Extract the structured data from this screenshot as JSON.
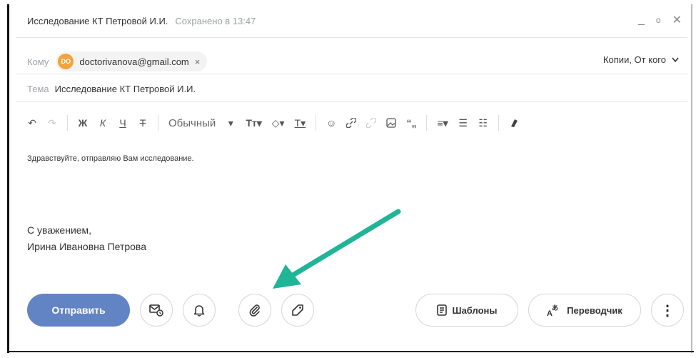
{
  "window": {
    "title": "Исследование КТ Петровой И.И.",
    "saved_status": "Сохранено в 13:47",
    "minimize_glyph": "_",
    "restore_glyph": "o",
    "close_glyph": "✕"
  },
  "to_field": {
    "label": "Кому",
    "recipient_initials": "DO",
    "recipient_email": "doctorivanova@gmail.com",
    "remove_glyph": "×",
    "cc_label": "Копии, От кого",
    "cc_chevron": "v"
  },
  "subject": {
    "label": "Тема",
    "value": "Исследование КТ Петровой И.И."
  },
  "toolbar": {
    "undo": "↶",
    "redo": "↷",
    "bold": "Ж",
    "italic": "К",
    "underline": "Ч",
    "strike": "Т",
    "font_style": "Обычный",
    "font_dropdown": "▾",
    "text_size": "Тт▾",
    "fill_color": "◇▾",
    "text_color": "T▾",
    "emoji": "☺",
    "link": "🔗",
    "unlink": "⛓",
    "image": "🖼",
    "quote": "“„",
    "align": "≡▾",
    "bullet_list": "☰",
    "numbered_list": "☷",
    "clear_format": "⌫"
  },
  "message": {
    "body": "Здравствуйте, отправляю Вам исследование.",
    "sign_line1": "С уважением,",
    "sign_line2": "Ирина Ивановна Петрова"
  },
  "actions": {
    "send_label": "Отправить",
    "templates_label": "Шаблоны",
    "translator_label": "Переводчик",
    "more_glyph": "⋮"
  },
  "colors": {
    "send_button": "#6384c4",
    "avatar": "#f4a33b",
    "annotation_arrow": "#1fb596"
  },
  "icons": [
    "undo-icon",
    "redo-icon",
    "delayed-send-icon",
    "reminder-bell-icon",
    "attach-paperclip-icon",
    "tag-icon",
    "templates-icon",
    "translate-icon",
    "more-icon"
  ]
}
